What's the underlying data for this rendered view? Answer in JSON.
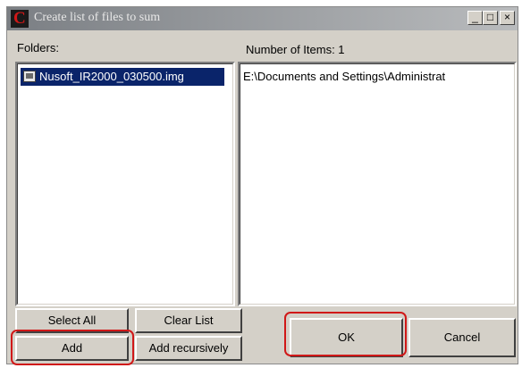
{
  "window": {
    "title": "Create list of files to sum",
    "controls": {
      "minimize": "_",
      "maximize": "□",
      "close": "×"
    }
  },
  "folders_panel": {
    "label": "Folders:",
    "items": [
      {
        "name": "Nusoft_IR2000_030500.img",
        "selected": true,
        "icon": "disk-image-icon"
      }
    ]
  },
  "items_panel": {
    "label": "Number of Items: 1",
    "items": [
      "E:\\Documents and Settings\\Administrat"
    ]
  },
  "buttons": {
    "select_all": "Select All",
    "clear_list": "Clear List",
    "add": "Add",
    "add_recursively": "Add recursively",
    "ok": "OK",
    "cancel": "Cancel"
  },
  "colors": {
    "selection": "#0a246a",
    "highlight": "#d01818",
    "dialog_face": "#d4d0c8"
  }
}
